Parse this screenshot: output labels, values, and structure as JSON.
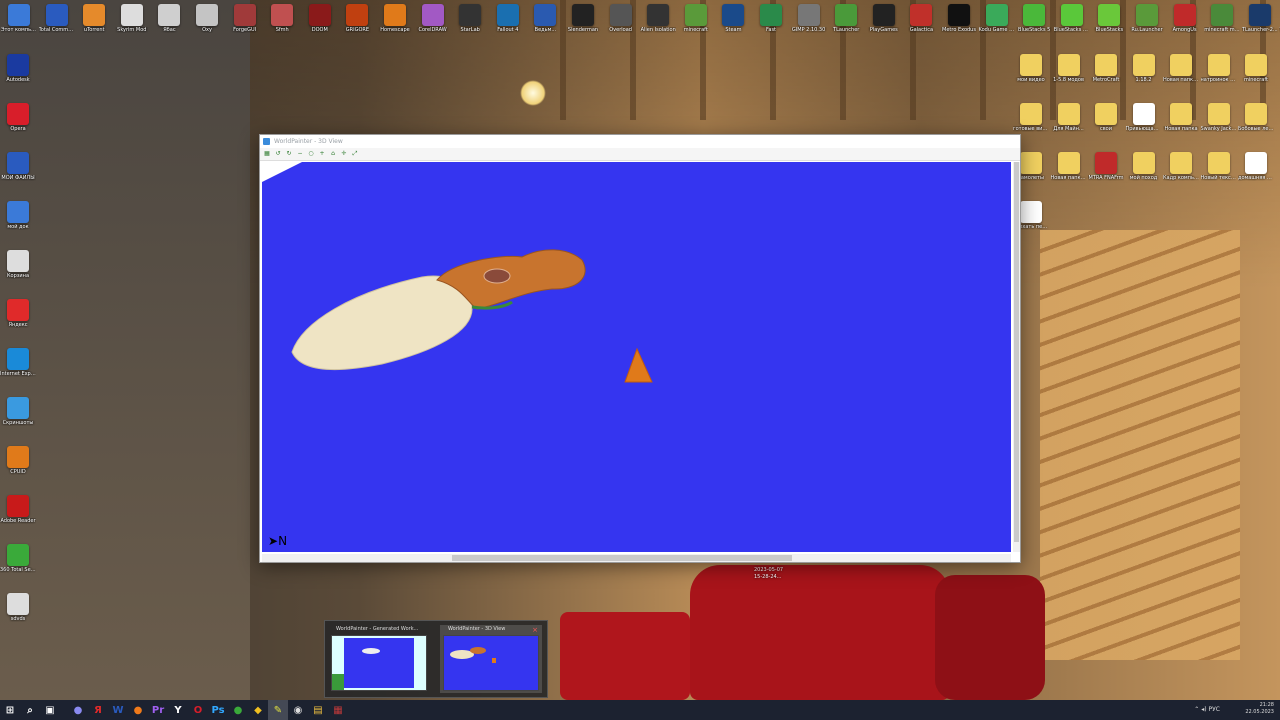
{
  "desktop": {
    "row1": [
      {
        "label": "Этот компьютер",
        "color": "#3b7ad8"
      },
      {
        "label": "Total Commander",
        "color": "#2a5bbf"
      },
      {
        "label": "uTorrent",
        "color": "#e58a2b"
      },
      {
        "label": "Skyrim Mod",
        "color": "#ddd"
      },
      {
        "label": "Ябас",
        "color": "#cfcfcf"
      },
      {
        "label": "Oxy",
        "color": "#c4c4c4"
      },
      {
        "label": "ForgeGUI",
        "color": "#a03a3a"
      },
      {
        "label": "Sfmh",
        "color": "#c05050"
      },
      {
        "label": "DOOM",
        "color": "#8a1a1a"
      },
      {
        "label": "GRIGORE",
        "color": "#c04010"
      },
      {
        "label": "Homescape",
        "color": "#e07a1a"
      },
      {
        "label": "CorelDRAW",
        "color": "#a259c4"
      },
      {
        "label": "StarLab",
        "color": "#333"
      },
      {
        "label": "Fallout 4",
        "color": "#1a6fb0"
      },
      {
        "label": "Ведьм...",
        "color": "#2a5ab0"
      },
      {
        "label": "Slenderman",
        "color": "#222"
      },
      {
        "label": "Overload",
        "color": "#555"
      },
      {
        "label": "Alien Isolation",
        "color": "#333"
      },
      {
        "label": "minecraft",
        "color": "#5a9a3a"
      },
      {
        "label": "Steam",
        "color": "#1a4a8a"
      },
      {
        "label": "Fast",
        "color": "#2a8a4a"
      },
      {
        "label": "GIMP 2.10.30",
        "color": "#777"
      },
      {
        "label": "TLauncher",
        "color": "#4a9a3a"
      },
      {
        "label": "PlayGames",
        "color": "#222"
      },
      {
        "label": "Galactica",
        "color": "#c0302a"
      },
      {
        "label": "Metro Exodus",
        "color": "#111"
      },
      {
        "label": "Kodu Game Lab",
        "color": "#3aaa5a"
      },
      {
        "label": "BlueStacks 5",
        "color": "#4ab83a"
      },
      {
        "label": "BlueStacks 5 Multi-Insta...",
        "color": "#5ac83a"
      },
      {
        "label": "BlueStacks",
        "color": "#6ac83a"
      },
      {
        "label": "Ru.Launcher",
        "color": "#5a9a3a"
      },
      {
        "label": "AmongUs",
        "color": "#c02a2a"
      },
      {
        "label": "minecraft mods",
        "color": "#4a8a3a"
      },
      {
        "label": "TLauncher-2...",
        "color": "#1a3a6a"
      },
      {
        "label": "TLauncher-2...",
        "color": "#1a3a6a"
      }
    ],
    "left_column": [
      {
        "label": "Autodesk",
        "color": "#1a3aa0"
      },
      {
        "label": "Opera",
        "color": "#d81e2a"
      },
      {
        "label": "МОИ ФАЙЛЫ",
        "color": "#2a5bbf"
      },
      {
        "label": "мой док",
        "color": "#3b7ad8"
      },
      {
        "label": "Корзина",
        "color": "#ddd"
      },
      {
        "label": "Яндекс",
        "color": "#e02a2a"
      },
      {
        "label": "Internet Explorer",
        "color": "#1a8ad8"
      },
      {
        "label": "Скриншоты",
        "color": "#3a9ae0"
      },
      {
        "label": "CPUID",
        "color": "#e07a1a"
      },
      {
        "label": "Adobe Reader",
        "color": "#c81a1a"
      },
      {
        "label": "360 Total Security",
        "color": "#3aaa3a"
      },
      {
        "label": "sdvds",
        "color": "#ddd"
      }
    ],
    "right_icons": [
      {
        "label": "мои видео",
        "color": "#f0d060"
      },
      {
        "label": "1-5.8 модов",
        "color": "#f0d060"
      },
      {
        "label": "MetroCraft",
        "color": "#f0d060"
      },
      {
        "label": "1.18.2",
        "color": "#f0d060"
      },
      {
        "label": "Новая папка (2)",
        "color": "#f0d060"
      },
      {
        "label": "натроинок 1.12.2",
        "color": "#f0d060"
      },
      {
        "label": "minecraft",
        "color": "#f0d060"
      },
      {
        "label": "готовые видео",
        "color": "#f0d060"
      },
      {
        "label": "Для Майн...",
        "color": "#f0d060"
      },
      {
        "label": "свои",
        "color": "#f0d060"
      },
      {
        "label": "Привьющая Microsoft R...",
        "color": "#fff"
      },
      {
        "label": "Новая папка",
        "color": "#f0d060"
      },
      {
        "label": "Swanky Jacks Disap...",
        "color": "#f0d060"
      },
      {
        "label": "Бобовые лечен-Knun...",
        "color": "#f0d060"
      },
      {
        "label": "самолеты",
        "color": "#f0d060"
      },
      {
        "label": "Новая папка (4)",
        "color": "#f0d060"
      },
      {
        "label": "MTRA FNAFrm",
        "color": "#c02a2a"
      },
      {
        "label": "мой поход",
        "color": "#f0d060"
      },
      {
        "label": "Кадр компьюта",
        "color": "#f0d060"
      },
      {
        "label": "Новый текстовый...",
        "color": "#f0d060"
      },
      {
        "label": "домашняя работа",
        "color": "#fff"
      },
      {
        "label": "поехать пешком",
        "color": "#fff"
      }
    ]
  },
  "window": {
    "title": "WorldPainter - 3D View",
    "compass": "N"
  },
  "timestamp": {
    "date": "2023-05-07",
    "time": "15-28-24..."
  },
  "thumbnails": [
    {
      "title": "WorldPainter - Generated Work...",
      "active": false
    },
    {
      "title": "WorldPainter - 3D View",
      "active": true
    }
  ],
  "taskbar": {
    "apps": [
      {
        "name": "start",
        "glyph": "⊞",
        "color": "#fff"
      },
      {
        "name": "search",
        "glyph": "⌕",
        "color": "#fff"
      },
      {
        "name": "task-view",
        "glyph": "▣",
        "color": "#fff"
      },
      {
        "name": "cortana",
        "glyph": "●",
        "color": "#8a8af0"
      },
      {
        "name": "yandex",
        "glyph": "Я",
        "color": "#e02a2a"
      },
      {
        "name": "word",
        "glyph": "W",
        "color": "#2a5bbf"
      },
      {
        "name": "firefox",
        "glyph": "●",
        "color": "#f07a1a"
      },
      {
        "name": "premiere",
        "glyph": "Pr",
        "color": "#a060f0"
      },
      {
        "name": "yandex-browser",
        "glyph": "Y",
        "color": "#fff"
      },
      {
        "name": "opera",
        "glyph": "O",
        "color": "#d81e2a"
      },
      {
        "name": "photoshop",
        "glyph": "Ps",
        "color": "#31a8ff"
      },
      {
        "name": "chrome",
        "glyph": "●",
        "color": "#3aaa3a"
      },
      {
        "name": "bandicam",
        "glyph": "◆",
        "color": "#f0c020"
      },
      {
        "name": "worldpainter",
        "glyph": "✎",
        "color": "#e0e040"
      },
      {
        "name": "obs",
        "glyph": "◉",
        "color": "#ddd"
      },
      {
        "name": "explorer",
        "glyph": "▤",
        "color": "#f0c040"
      },
      {
        "name": "winrar",
        "glyph": "▦",
        "color": "#c03a3a"
      }
    ],
    "lang": "РУС",
    "clock_time": "21:28",
    "clock_date": "22.05.2023"
  }
}
